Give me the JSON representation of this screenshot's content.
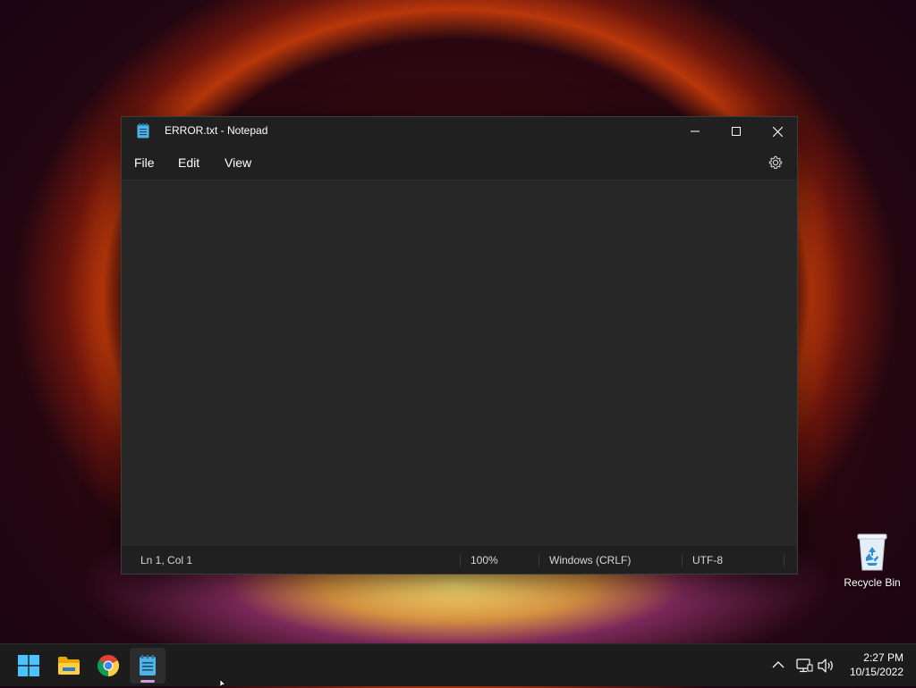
{
  "window": {
    "title": "ERROR.txt - Notepad",
    "app_icon": "notepad-icon",
    "controls": {
      "minimize": "minimize-icon",
      "maximize": "maximize-icon",
      "close": "close-icon"
    }
  },
  "menu": {
    "items": [
      {
        "label": "File"
      },
      {
        "label": "Edit"
      },
      {
        "label": "View"
      }
    ],
    "settings_icon": "gear-icon"
  },
  "editor": {
    "content": ""
  },
  "statusbar": {
    "position": "Ln 1, Col 1",
    "zoom": "100%",
    "line_ending": "Windows (CRLF)",
    "encoding": "UTF-8"
  },
  "desktop": {
    "icons": [
      {
        "label": "Recycle Bin",
        "icon": "recycle-bin-icon"
      }
    ]
  },
  "taskbar": {
    "apps": [
      {
        "name": "Start",
        "icon": "windows-start-icon"
      },
      {
        "name": "File Explorer",
        "icon": "folder-icon"
      },
      {
        "name": "Google Chrome",
        "icon": "chrome-icon"
      },
      {
        "name": "Notepad",
        "icon": "notepad-icon",
        "active": true
      }
    ],
    "tray": {
      "chevron": "chevron-up-icon",
      "network": "network-icon",
      "volume": "volume-icon"
    },
    "clock": {
      "time": "2:27 PM",
      "date": "10/15/2022"
    }
  },
  "colors": {
    "accent": "#60cdff",
    "window_bg": "#272727",
    "chrome_bg": "#202020",
    "taskbar_bg": "#1c1c1c"
  }
}
